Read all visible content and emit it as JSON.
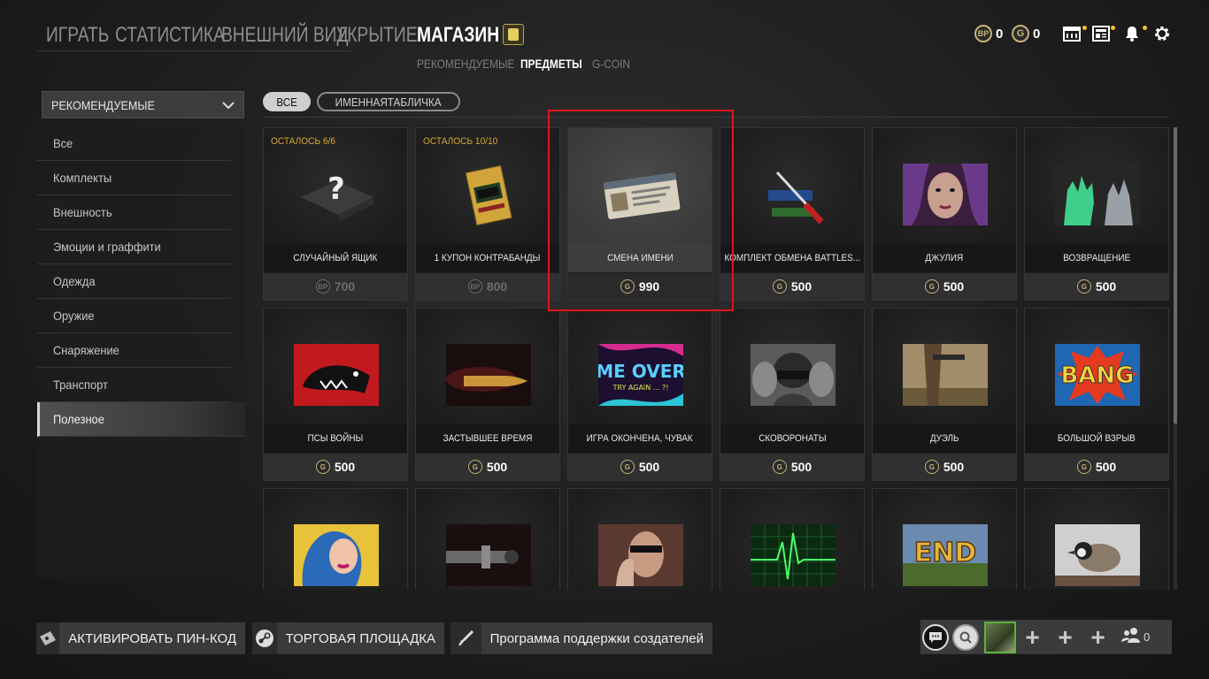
{
  "top_nav": {
    "items": [
      {
        "label": "ИГРАТЬ",
        "active": false
      },
      {
        "label": "СТАТИСТИКА",
        "active": false
      },
      {
        "label": "ВНЕШНИЙ ВИД",
        "active": false
      },
      {
        "label": "УКРЫТИЕ",
        "active": false
      },
      {
        "label": "МАГАЗИН",
        "active": true
      }
    ]
  },
  "sub_nav": {
    "items": [
      {
        "label": "РЕКОМЕНДУЕМЫЕ",
        "active": false
      },
      {
        "label": "ПРЕДМЕТЫ",
        "active": true
      },
      {
        "label": "G-COIN",
        "active": false
      }
    ]
  },
  "currencies": {
    "bp": {
      "icon": "BP",
      "amount": "0"
    },
    "gcoin": {
      "icon": "G",
      "amount": "0"
    }
  },
  "colors": {
    "accent_gold": "#c7b27a",
    "remaining_text": "#d6a833",
    "selection_outline": "#e0161b",
    "notification_dot": "#f1c232"
  },
  "sidebar": {
    "dropdown_label": "РЕКОМЕНДУЕМЫЕ",
    "items": [
      {
        "label": "Все",
        "active": false
      },
      {
        "label": "Комплекты",
        "active": false
      },
      {
        "label": "Внешность",
        "active": false
      },
      {
        "label": "Эмоции и граффити",
        "active": false
      },
      {
        "label": "Одежда",
        "active": false
      },
      {
        "label": "Оружие",
        "active": false
      },
      {
        "label": "Снаряжение",
        "active": false
      },
      {
        "label": "Транспорт",
        "active": false
      },
      {
        "label": "Полезное",
        "active": true
      }
    ]
  },
  "filters": [
    {
      "label": "ВСЕ",
      "active": true
    },
    {
      "label": "ИМЕННАЯТАБЛИЧКА",
      "active": false
    }
  ],
  "items": [
    {
      "name": "СЛУЧАЙНЫЙ ЯЩИК",
      "remaining": "ОСТАЛОСЬ 6/6",
      "currency": "BP",
      "price": "700",
      "disabled": true,
      "art": "crate"
    },
    {
      "name": "1 КУПОН КОНТРАБАНДЫ",
      "remaining": "ОСТАЛОСЬ 10/10",
      "currency": "BP",
      "price": "800",
      "disabled": true,
      "art": "coupon"
    },
    {
      "name": "СМЕНА ИМЕНИ",
      "remaining": "",
      "currency": "G",
      "price": "990",
      "selected": true,
      "art": "idcard"
    },
    {
      "name": "КОМПЛЕКТ ОБМЕНА BATTLES...",
      "remaining": "",
      "currency": "G",
      "price": "500",
      "art": "tools"
    },
    {
      "name": "ДЖУЛИЯ",
      "remaining": "",
      "currency": "G",
      "price": "500",
      "art": "julia"
    },
    {
      "name": "ВОЗВРАЩЕНИЕ",
      "remaining": "",
      "currency": "G",
      "price": "500",
      "art": "return"
    },
    {
      "name": "ПСЫ ВОЙНЫ",
      "remaining": "",
      "currency": "G",
      "price": "500",
      "art": "dogs"
    },
    {
      "name": "ЗАСТЫВШЕЕ ВРЕМЯ",
      "remaining": "",
      "currency": "G",
      "price": "500",
      "art": "bullet"
    },
    {
      "name": "ИГРА ОКОНЧЕНА, ЧУВАК",
      "remaining": "",
      "currency": "G",
      "price": "500",
      "art": "gameover",
      "art_text": "ME OVER",
      "art_subtext": "TRY AGAIN ... ?!"
    },
    {
      "name": "СКОВОРОНАТЫ",
      "remaining": "",
      "currency": "G",
      "price": "500",
      "art": "helmet"
    },
    {
      "name": "ДУЭЛЬ",
      "remaining": "",
      "currency": "G",
      "price": "500",
      "art": "duel"
    },
    {
      "name": "БОЛЬШОЙ ВЗРЫВ",
      "remaining": "",
      "currency": "G",
      "price": "500",
      "art": "bang",
      "art_text": "BANG"
    },
    {
      "name": "",
      "remaining": "",
      "currency": "",
      "price": "",
      "art": "comicgirl"
    },
    {
      "name": "",
      "remaining": "",
      "currency": "",
      "price": "",
      "art": "gun"
    },
    {
      "name": "",
      "remaining": "",
      "currency": "",
      "price": "",
      "art": "woman"
    },
    {
      "name": "",
      "remaining": "",
      "currency": "",
      "price": "",
      "art": "heartbeat"
    },
    {
      "name": "",
      "remaining": "",
      "currency": "",
      "price": "",
      "art": "end",
      "art_text": "END"
    },
    {
      "name": "",
      "remaining": "",
      "currency": "",
      "price": "",
      "art": "bird"
    }
  ],
  "bottom_bar": {
    "pin_button": {
      "label": "АКТИВИРОВАТЬ ПИН-КОД",
      "icon": "ticket-icon"
    },
    "market_button": {
      "label": "ТОРГОВАЯ ПЛОЩАДКА",
      "icon": "steam-icon"
    },
    "creator_button": {
      "label": "Программа поддержки создателей",
      "icon": "brush-icon"
    }
  },
  "social": {
    "friend_count": "0"
  }
}
